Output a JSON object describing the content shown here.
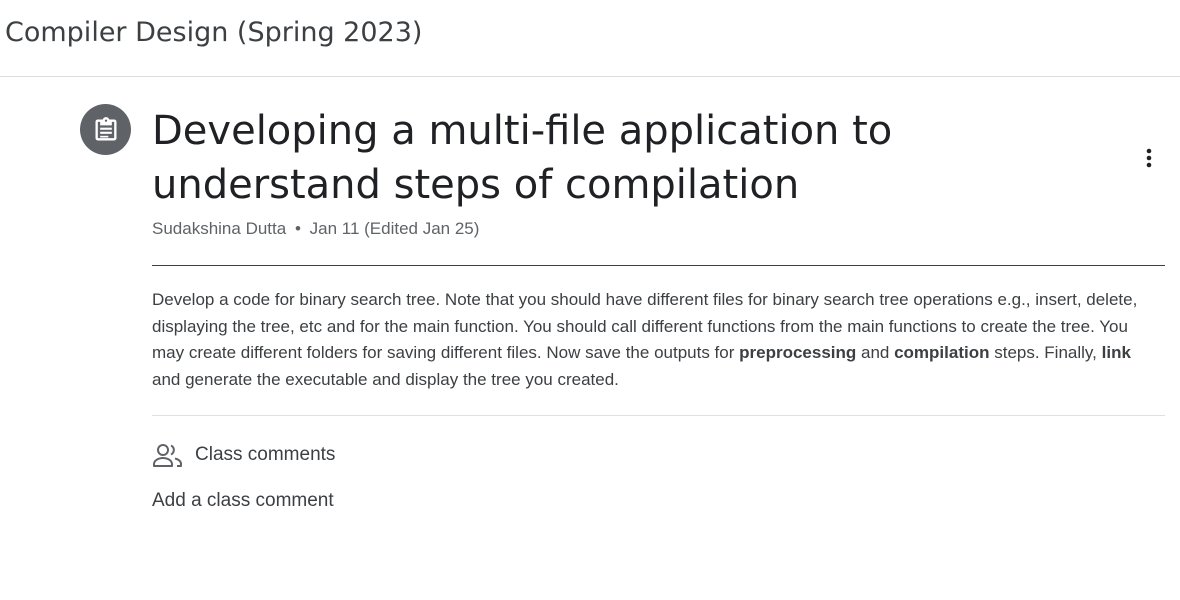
{
  "header": {
    "course_title": "Compiler Design (Spring 2023)"
  },
  "assignment": {
    "icon": "assignment-icon",
    "title": "Developing a multi-file application to understand steps of compilation",
    "author": "Sudakshina Dutta",
    "separator": "•",
    "date": "Jan 11 (Edited Jan 25)",
    "menu_icon": "more-vert-icon",
    "description": {
      "part1": "Develop a code for binary search tree. Note that you should have different files for binary search tree operations e.g., insert, delete, displaying the tree, etc and for the main function. You should call different functions from the main functions to create the tree. You may create different folders for saving different files. Now save the outputs for ",
      "bold1": "preprocessing",
      "part2": " and ",
      "bold2": "compilation",
      "part3": " steps. Finally, ",
      "bold3": "link",
      "part4": " and generate the executable and display the tree you created."
    }
  },
  "comments": {
    "icon": "people-icon",
    "label": "Class comments",
    "add_label": "Add a class comment"
  },
  "colors": {
    "icon_circle": "#5f6368",
    "title_text": "#202124",
    "body_text": "#3c4043",
    "meta_text": "#5f6368"
  }
}
